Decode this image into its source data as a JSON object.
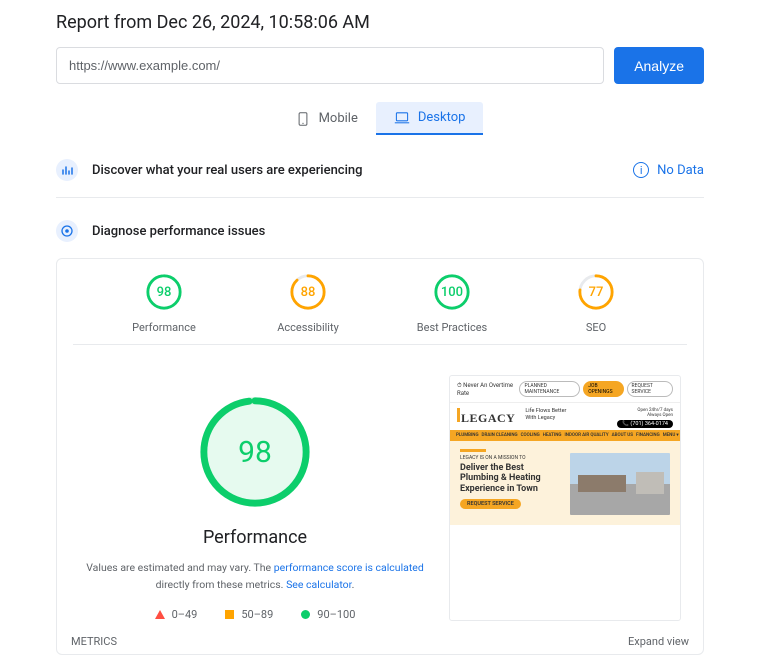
{
  "report_title": "Report from Dec 26, 2024, 10:58:06 AM",
  "url_input": {
    "value": "https://www.example.com/"
  },
  "analyze_label": "Analyze",
  "tabs": {
    "mobile": "Mobile",
    "desktop": "Desktop"
  },
  "section_real_users": "Discover what your real users are experiencing",
  "no_data": "No Data",
  "section_diagnose": "Diagnose performance issues",
  "scores": {
    "performance": {
      "value": "98",
      "label": "Performance",
      "color": "#0cce6b",
      "pct": 98
    },
    "accessibility": {
      "value": "88",
      "label": "Accessibility",
      "color": "#ffa400",
      "pct": 88
    },
    "best_practices": {
      "value": "100",
      "label": "Best Practices",
      "color": "#0cce6b",
      "pct": 100
    },
    "seo": {
      "value": "77",
      "label": "SEO",
      "color": "#ffa400",
      "pct": 77
    }
  },
  "big_score": {
    "value": "98",
    "label": "Performance",
    "pct": 98
  },
  "desc": {
    "prefix": "Values are estimated and may vary. The ",
    "link1": "performance score is calculated",
    "mid": " directly from these metrics. ",
    "link2": "See calculator"
  },
  "legend": {
    "r1": "0–49",
    "r2": "50–89",
    "r3": "90–100"
  },
  "screenshot": {
    "topnote": "Never An Overtime Rate",
    "pills": [
      "PLANNED MAINTENANCE",
      "JOB OPENINGS",
      "REQUEST SERVICE"
    ],
    "logo": "LEGACY",
    "tagline1": "Life Flows Better",
    "tagline2": "With Legacy",
    "sub1": "Open 24hr/7 days",
    "sub2": "Always Open",
    "phone": "(701) 364-0174",
    "nav": [
      "PLUMBING",
      "DRAIN CLEANING",
      "COOLING",
      "HEATING",
      "INDOOR AIR QUALITY",
      "ABOUT US",
      "FINANCING",
      "MENU ▾"
    ],
    "kicker": "LEGACY IS ON A MISSION TO",
    "h1": "Deliver the Best",
    "h2": "Plumbing & Heating",
    "h3": "Experience in Town",
    "cta": "REQUEST SERVICE"
  },
  "footer": {
    "metrics": "METRICS",
    "expand": "Expand view"
  }
}
